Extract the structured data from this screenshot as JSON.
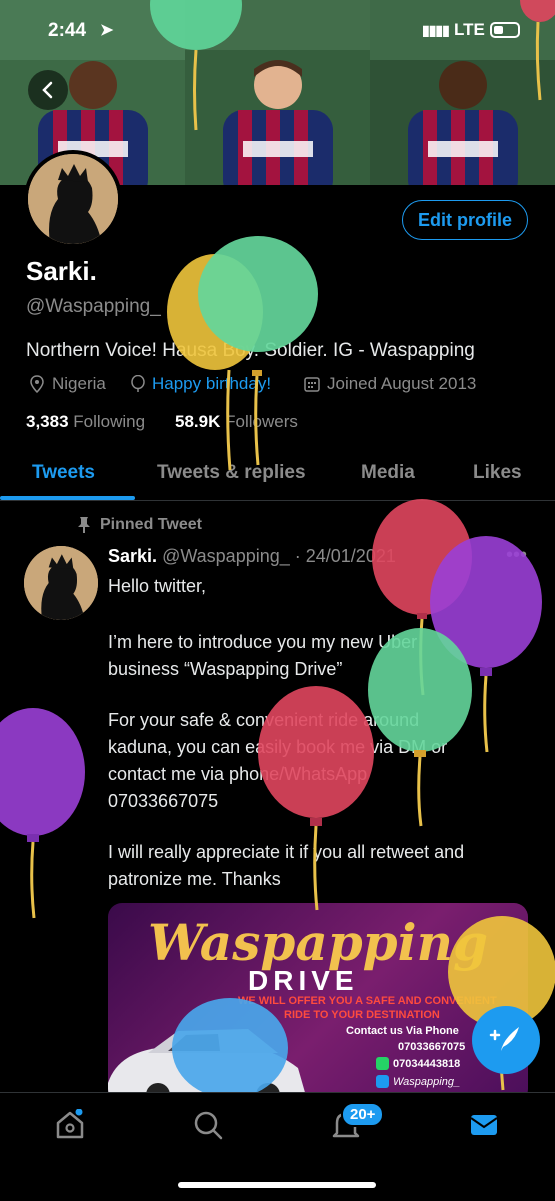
{
  "status_bar": {
    "time": "2:44",
    "network": "LTE"
  },
  "profile": {
    "name": "Sarki.",
    "handle": "@Waspapping_",
    "edit_label": "Edit profile",
    "bio": "Northern Voice! Hausa Boy. Soldier. IG - Waspapping",
    "location": "Nigeria",
    "birthday_text": "Happy birthday!",
    "joined": "Joined August 2013",
    "following_count": "3,383",
    "following_label": "Following",
    "followers_count": "58.9K",
    "followers_label": "Followers"
  },
  "tabs": [
    "Tweets",
    "Tweets & replies",
    "Media",
    "Likes"
  ],
  "pinned_tweet": {
    "pinned_label": "Pinned Tweet",
    "author_name": "Sarki.",
    "author_handle": "@Waspapping_",
    "date": "· 24/01/2021",
    "lines": [
      "Hello twitter,",
      "I’m here to introduce you my new Uber",
      "business “Waspapping Drive”",
      "For your safe & convenient ride around",
      "kaduna, you can easily book me via DM or",
      "contact me via phone/WhatsApp",
      "07033667075",
      "I will really appreciate it if you all retweet and",
      "patronize me. Thanks"
    ],
    "image": {
      "title": "Waspapping",
      "subtitle": "DRIVE",
      "offer_line1": "We Will Offer You a Safe and Convenient",
      "offer_line2": "Ride to Your Destination",
      "contact_label": "Contact us Via Phone",
      "phone1": "07033667075",
      "phone2": "07034443818",
      "twitter": "Waspapping_"
    }
  },
  "nav": {
    "notifications_badge": "20+"
  },
  "colors": {
    "accent": "#1d9bf0",
    "background": "#000000",
    "muted": "#8b8b8b"
  },
  "icons": [
    "back-arrow-icon",
    "location-icon",
    "balloon-icon",
    "calendar-icon",
    "pin-icon",
    "home-icon",
    "search-icon",
    "bell-icon",
    "mail-icon",
    "compose-icon"
  ]
}
